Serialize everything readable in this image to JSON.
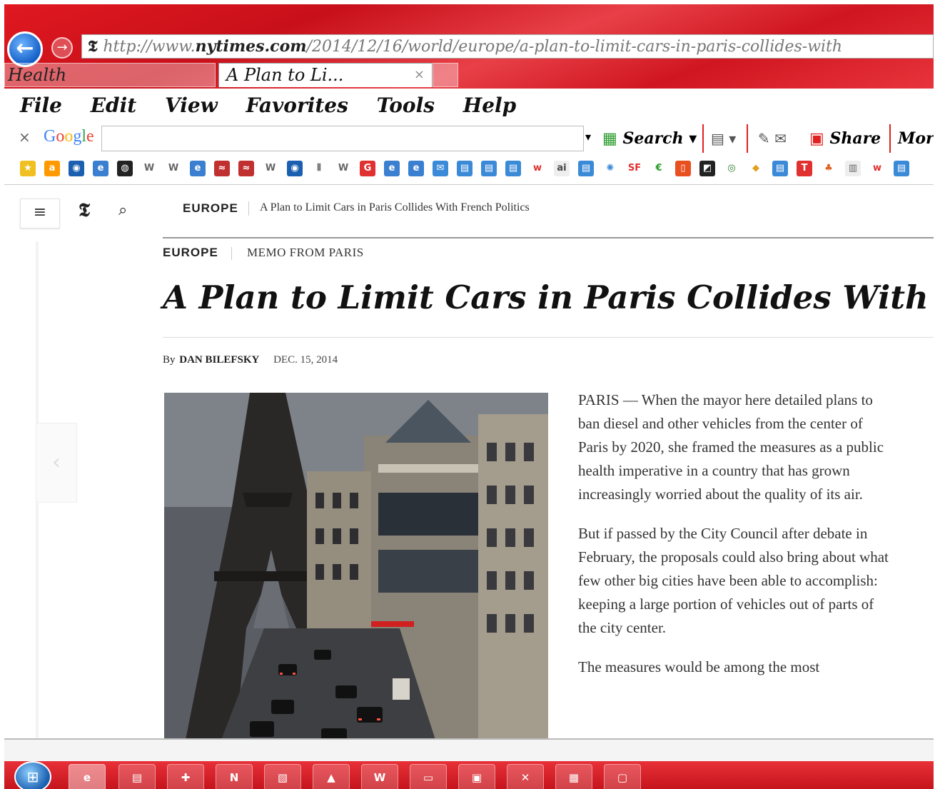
{
  "browser": {
    "back_icon": "arrow-left-icon",
    "forward_icon": "arrow-right-icon",
    "address_favicon": "𝕿",
    "address_prefix": "http://www.",
    "address_domain": "nytimes.com",
    "address_rest": "/2014/12/16/world/europe/a-plan-to-limit-cars-in-paris-collides-with",
    "tabs": [
      {
        "label": "Health"
      },
      {
        "label": "A Plan to Li...",
        "close": "×"
      }
    ],
    "menu": [
      "File",
      "Edit",
      "View",
      "Favorites",
      "Tools",
      "Help"
    ],
    "google_bar": {
      "close": "×",
      "logo": "Google",
      "search_label": "Search",
      "share_label": "Share",
      "more_label": "Mor"
    }
  },
  "nyt_bar": {
    "menu_icon": "≡",
    "logo": "𝕿",
    "search_icon": "⌕",
    "section": "EUROPE",
    "headline": "A Plan to Limit Cars in Paris Collides With French Politics"
  },
  "article": {
    "kicker_section": "EUROPE",
    "kicker_column": "MEMO FROM PARIS",
    "headline": "A Plan to Limit Cars in Paris Collides With French",
    "byline_prefix": "By",
    "byline_name": "DAN BILEFSKY",
    "date": "DEC. 15, 2014",
    "paragraphs": [
      "PARIS — When the mayor here detailed plans to ban diesel and other vehicles from the center of Paris by 2020, she framed the measures as a public health imperative in a country that has grown increasingly worried about the quality of its air.",
      "But if passed by the City Council after debate in February, the proposals could also bring about what few other big cities have been able to accomplish: keeping a large portion of vehicles out of parts of the city center.",
      "The measures would be among the most"
    ],
    "prev_arrow": "‹"
  },
  "taskbar": {
    "start_icon": "windows-start-icon",
    "buttons": [
      "ie-icon",
      "notepad-icon",
      "app-icon",
      "onenote-icon",
      "paint-icon",
      "pdf-icon",
      "word-icon",
      "computer-icon",
      "display-icon",
      "close-icon",
      "explorer-icon",
      "window-icon"
    ]
  },
  "colors": {
    "chrome_red": "#d01620",
    "taskbar_red": "#c01018",
    "link_text": "#222222"
  }
}
